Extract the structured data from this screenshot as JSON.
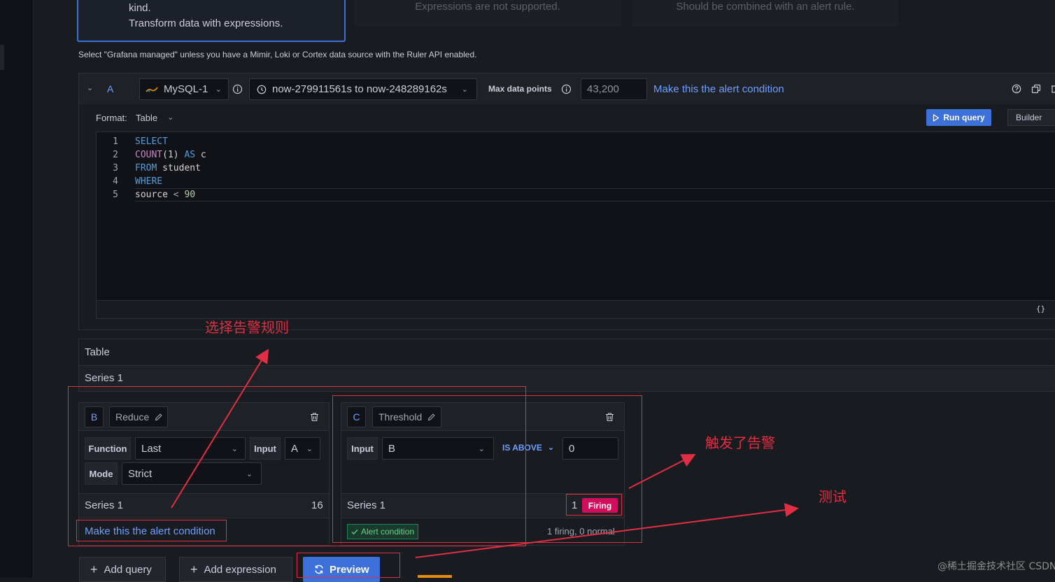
{
  "cards": {
    "selected_line1": "kind.",
    "selected_line2": "Transform data with expressions.",
    "mid": "Expressions are not supported.",
    "right": "Should be combined with an alert rule."
  },
  "hint": "Select \"Grafana managed\" unless you have a Mimir, Loki or Cortex data source with the Ruler API enabled.",
  "query": {
    "ref": "A",
    "datasource": "MySQL-1",
    "time_range": "now-279911561s to now-248289162s",
    "max_points_label": "Max data points",
    "max_points_value": "43,200",
    "alert_link": "Make this the alert condition",
    "format_label": "Format:",
    "format_value": "Table",
    "run_query": "Run query",
    "builder": "Builder",
    "lines": [
      {
        "n": "1",
        "parts": [
          {
            "t": "SELECT",
            "c": "kw"
          }
        ]
      },
      {
        "n": "2",
        "parts": [
          {
            "t": "COUNT",
            "c": "fn"
          },
          {
            "t": "(1) ",
            "c": "tx"
          },
          {
            "t": "AS",
            "c": "kw"
          },
          {
            "t": " c",
            "c": "tx"
          }
        ]
      },
      {
        "n": "3",
        "parts": [
          {
            "t": "FROM",
            "c": "kw"
          },
          {
            "t": " student",
            "c": "tx"
          }
        ]
      },
      {
        "n": "4",
        "parts": [
          {
            "t": "WHERE",
            "c": "kw"
          }
        ]
      },
      {
        "n": "5",
        "parts": [
          {
            "t": "source ",
            "c": "tx"
          },
          {
            "t": "<",
            "c": "op"
          },
          {
            "t": " 90",
            "c": "num"
          }
        ]
      }
    ],
    "braces": "{}"
  },
  "results": {
    "table_label": "Table",
    "series_label": "Series 1"
  },
  "expr_b": {
    "ref": "B",
    "type": "Reduce",
    "function_label": "Function",
    "function_value": "Last",
    "input_label": "Input",
    "input_value": "A",
    "mode_label": "Mode",
    "mode_value": "Strict",
    "series_name": "Series 1",
    "series_value": "16",
    "alert_link": "Make this the alert condition"
  },
  "expr_c": {
    "ref": "C",
    "type": "Threshold",
    "input_label": "Input",
    "input_value": "B",
    "condition": "IS ABOVE",
    "threshold": "0",
    "series_name": "Series 1",
    "series_value": "1",
    "state": "Firing",
    "alert_badge": "Alert condition",
    "summary": "1 firing, 0 normal"
  },
  "footer": {
    "add_query": "Add query",
    "add_expression": "Add expression",
    "preview": "Preview"
  },
  "annotations": {
    "select_rule": "选择告警规则",
    "alert_triggered": "触发了告警",
    "test": "测试"
  },
  "watermark": "@稀土掘金技术社区 CSDN @虚无境",
  "colors": {
    "link": "#6e9fff",
    "primary": "#3d71d9",
    "firing": "#d10e5c",
    "annotation": "#e02f44",
    "keyword": "#569cd6",
    "function": "#c586c0"
  }
}
